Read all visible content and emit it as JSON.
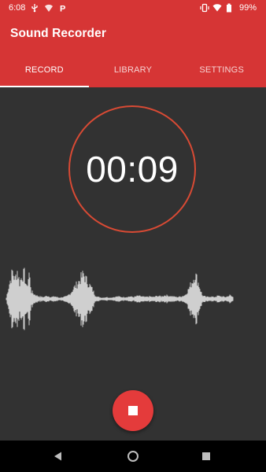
{
  "status_bar": {
    "time": "6:08",
    "battery": "99%"
  },
  "app": {
    "title": "Sound Recorder"
  },
  "tabs": [
    {
      "label": "RECORD",
      "active": true
    },
    {
      "label": "LIBRARY",
      "active": false
    },
    {
      "label": "SETTINGS",
      "active": false
    }
  ],
  "recorder": {
    "elapsed": "00:09",
    "action": "stop"
  },
  "colors": {
    "primary": "#D63535",
    "ring": "#D84A34",
    "fab": "#E43B3B",
    "background": "#323232",
    "waveform": "#CFCFCF"
  }
}
